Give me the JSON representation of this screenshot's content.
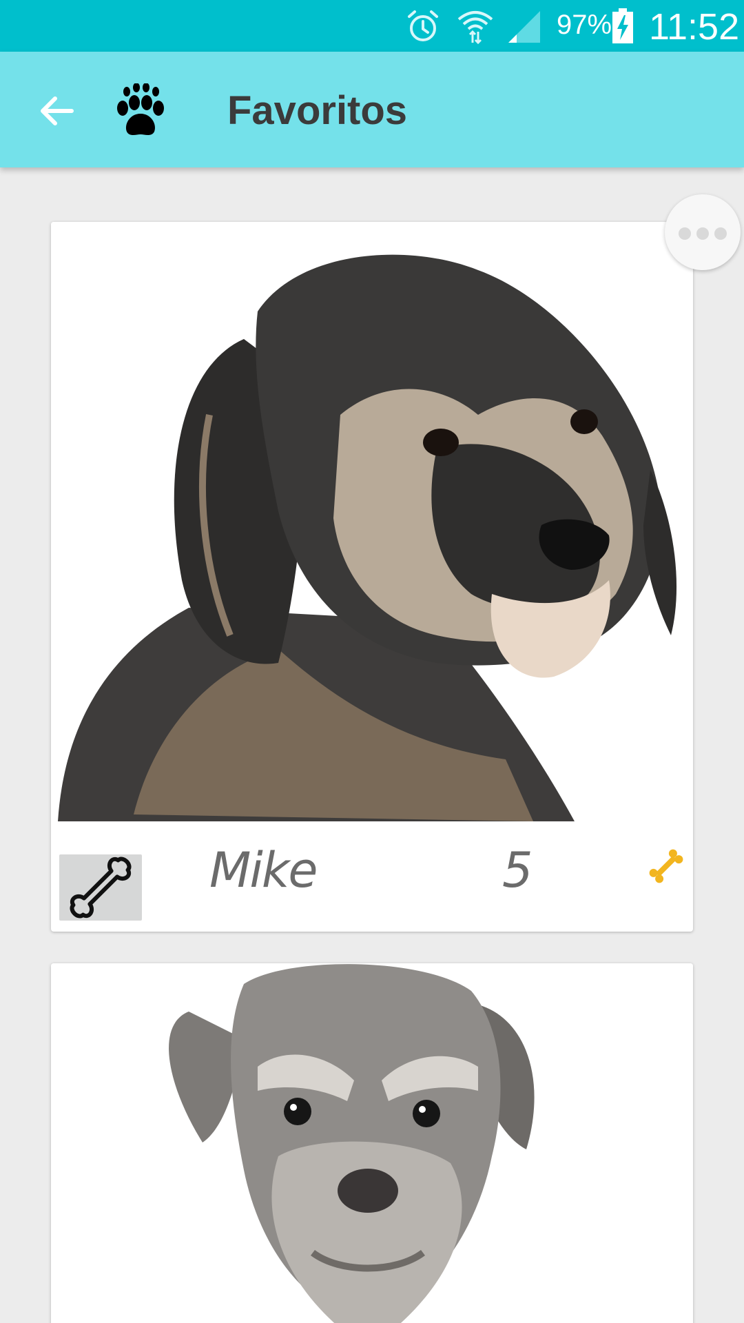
{
  "status_bar": {
    "battery_percent": "97%",
    "time": "11:52",
    "icons": [
      "alarm-icon",
      "wifi-icon",
      "signal-icon",
      "battery-charging-icon"
    ]
  },
  "app_bar": {
    "title": "Favoritos",
    "icons": [
      "back-arrow-icon",
      "paw-icon"
    ]
  },
  "favorites": [
    {
      "name": "Mike",
      "score": "5",
      "photo": "dog-photo-scruffy-black-tan"
    },
    {
      "photo": "dog-photo-grey-schnauzer"
    }
  ],
  "colors": {
    "status_bar": "#00bfcc",
    "app_bar": "#74e1ea",
    "background": "#ececec",
    "bone_gold": "#f2b51f"
  }
}
